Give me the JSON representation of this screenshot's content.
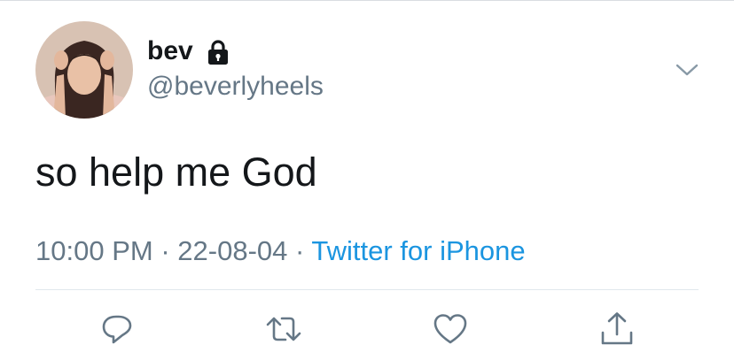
{
  "tweet": {
    "author": {
      "display_name": "bev",
      "handle": "@beverlyheels",
      "protected": true
    },
    "text": "so help me God",
    "time": "10:00 PM",
    "date": "22-08-04",
    "source": "Twitter for iPhone"
  },
  "meta_separator": "·",
  "icons": {
    "lock": "lock-icon",
    "menu": "chevron-down-icon",
    "reply": "reply-icon",
    "retweet": "retweet-icon",
    "like": "heart-icon",
    "share": "share-icon"
  },
  "colors": {
    "text": "#14171a",
    "secondary": "#657786",
    "link": "#1b95e0",
    "divider": "#e1e8ed"
  }
}
